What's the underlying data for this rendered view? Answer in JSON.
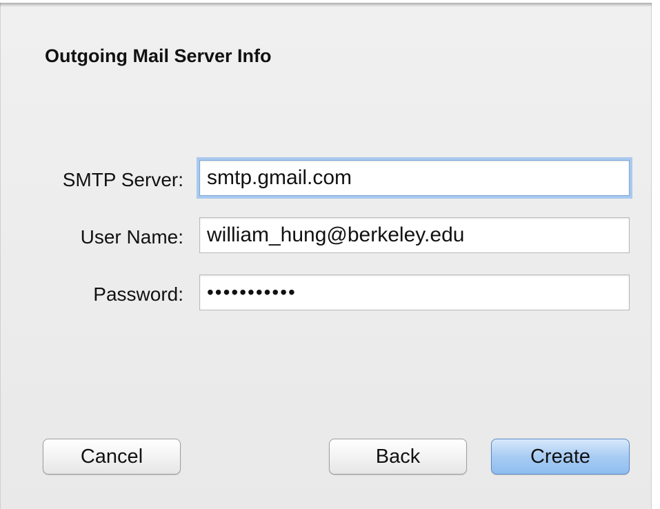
{
  "dialog": {
    "title": "Outgoing Mail Server Info"
  },
  "fields": {
    "smtp_server": {
      "label": "SMTP Server:",
      "value": "smtp.gmail.com"
    },
    "user_name": {
      "label": "User Name:",
      "value": "william_hung@berkeley.edu"
    },
    "password": {
      "label": "Password:",
      "value": "•••••••••••"
    }
  },
  "buttons": {
    "cancel": "Cancel",
    "back": "Back",
    "create": "Create"
  },
  "colors": {
    "focus_ring": "#a9c9ee",
    "default_button": "#a8ccf3"
  }
}
